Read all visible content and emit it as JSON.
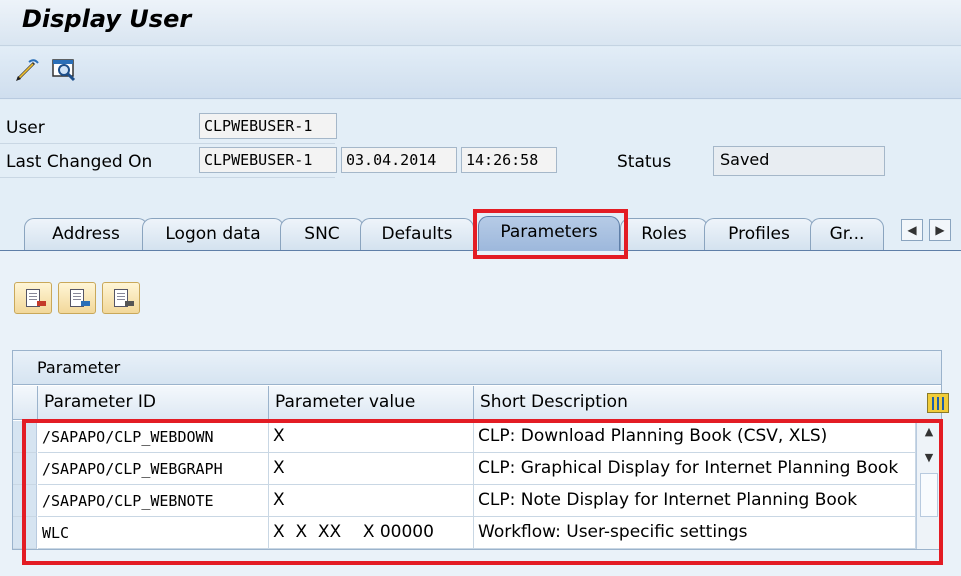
{
  "window": {
    "title": "Display User"
  },
  "toolbar": {
    "icons": [
      "edit-pencil-icon",
      "display-magnifier-icon"
    ]
  },
  "header": {
    "user_label": "User",
    "user_value": "CLPWEBUSER-1",
    "last_changed_label": "Last Changed On",
    "changed_by": "CLPWEBUSER-1",
    "changed_date": "03.04.2014",
    "changed_time": "14:26:58",
    "status_label": "Status",
    "status_value": "Saved"
  },
  "tabs": [
    {
      "label": "Address"
    },
    {
      "label": "Logon data"
    },
    {
      "label": "SNC"
    },
    {
      "label": "Defaults"
    },
    {
      "label": "Parameters",
      "active": true
    },
    {
      "label": "Roles"
    },
    {
      "label": "Profiles"
    },
    {
      "label": "Gr..."
    }
  ],
  "tab_scroll": {
    "left": "◀",
    "right": "▶"
  },
  "table": {
    "title": "Parameter",
    "columns": [
      "Parameter ID",
      "Parameter value",
      "Short Description"
    ],
    "rows": [
      {
        "id": "/SAPAPO/CLP_WEBDOWN",
        "value": "X",
        "desc": "CLP: Download Planning Book (CSV, XLS)"
      },
      {
        "id": "/SAPAPO/CLP_WEBGRAPH",
        "value": "X",
        "desc": "CLP: Graphical Display for Internet Planning Book"
      },
      {
        "id": "/SAPAPO/CLP_WEBNOTE",
        "value": "X",
        "desc": "CLP: Note Display for Internet Planning Book"
      },
      {
        "id": "WLC",
        "value": "X  X  XX    X 00000",
        "desc": "Workflow: User-specific settings"
      }
    ]
  },
  "colors": {
    "highlight": "#e31c24",
    "active_tab": "#9db8dc"
  }
}
